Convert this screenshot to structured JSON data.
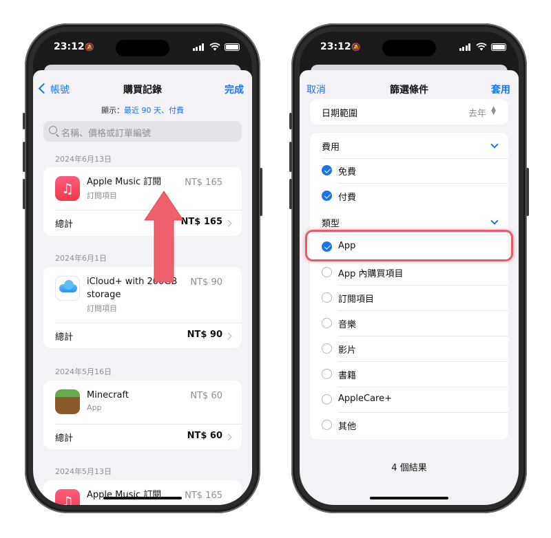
{
  "status": {
    "time": "23:12"
  },
  "left": {
    "nav": {
      "back": "帳號",
      "title": "購買記錄",
      "done": "完成"
    },
    "filter": {
      "prefix": "顯示：",
      "value": "最近 90 天、付費"
    },
    "search": {
      "placeholder": "名稱、價格或訂單編號"
    },
    "groups": [
      {
        "date": "2024年6月13日",
        "name": "Apple Music 訂閱",
        "type": "訂閱項目",
        "price": "NT$ 165",
        "total_label": "總計",
        "total": "NT$ 165",
        "icon": "music-icon"
      },
      {
        "date": "2024年6月1日",
        "name": "iCloud+ with 200GB storage",
        "type": "訂閱項目",
        "price": "NT$ 90",
        "total_label": "總計",
        "total": "NT$ 90",
        "icon": "icloud-icon"
      },
      {
        "date": "2024年5月16日",
        "name": "Minecraft",
        "type": "App",
        "price": "NT$ 60",
        "total_label": "總計",
        "total": "NT$ 60",
        "icon": "minecraft-icon"
      },
      {
        "date": "2024年5月13日",
        "name": "Apple Music 訂閱",
        "price": "NT$ 165",
        "icon": "music-icon"
      }
    ]
  },
  "right": {
    "nav": {
      "cancel": "取消",
      "title": "篩選條件",
      "apply": "套用"
    },
    "date_range": {
      "label": "日期範圍",
      "value": "去年"
    },
    "cost": {
      "label": "費用",
      "options": [
        {
          "label": "免費",
          "checked": true
        },
        {
          "label": "付費",
          "checked": true
        }
      ]
    },
    "category": {
      "label": "類型",
      "options": [
        {
          "label": "App",
          "checked": true
        },
        {
          "label": "App 內購買項目",
          "checked": false
        },
        {
          "label": "訂閱項目",
          "checked": false
        },
        {
          "label": "音樂",
          "checked": false
        },
        {
          "label": "影片",
          "checked": false
        },
        {
          "label": "書籍",
          "checked": false
        },
        {
          "label": "AppleCare+",
          "checked": false
        },
        {
          "label": "其他",
          "checked": false
        }
      ]
    },
    "results": "4 個結果"
  },
  "colors": {
    "accent": "#1a73e8",
    "highlight": "#ec5a66",
    "background": "#f2f2f7"
  }
}
